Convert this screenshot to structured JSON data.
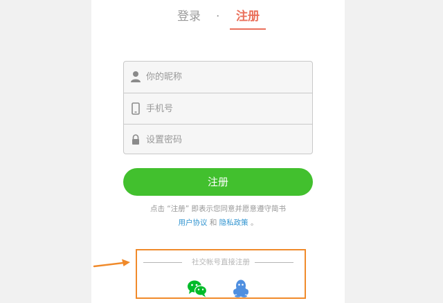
{
  "tabs": {
    "login_label": "登录",
    "separator": "·",
    "register_label": "注册"
  },
  "form": {
    "nickname_placeholder": "你的昵称",
    "phone_placeholder": "手机号",
    "password_placeholder": "设置密码",
    "submit_label": "注册"
  },
  "agreement": {
    "prefix": "点击 “注册” 即表示您同意并愿意遵守简书",
    "terms_link": "用户协议",
    "conjunction": "和",
    "privacy_link": "隐私政策",
    "suffix": "。"
  },
  "social": {
    "title": "社交帐号直接注册",
    "icons": [
      "wechat-icon",
      "qq-icon"
    ]
  },
  "colors": {
    "accent": "#ea6f5a",
    "button": "#42c02e",
    "link": "#3194d0",
    "highlight": "#f08a2a"
  }
}
